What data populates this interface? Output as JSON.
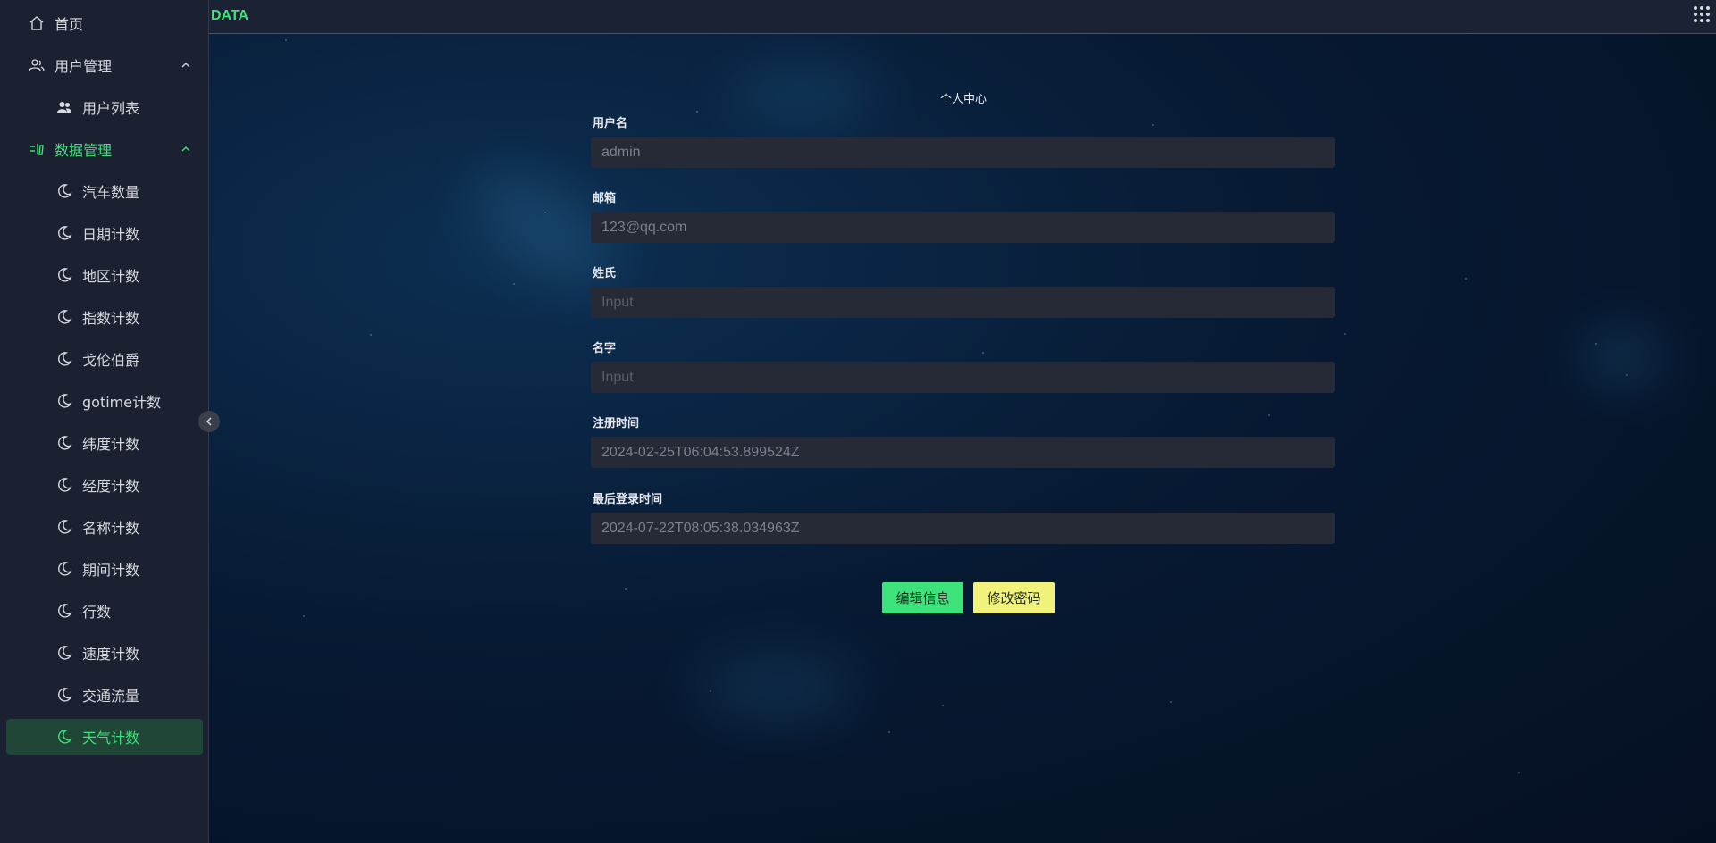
{
  "header": {
    "brand": "DATA"
  },
  "sidebar": {
    "home": "首页",
    "user_group": "用户管理",
    "user_list": "用户列表",
    "data_group": "数据管理",
    "data_items": [
      "汽车数量",
      "日期计数",
      "地区计数",
      "指数计数",
      "戈伦伯爵",
      "gotime计数",
      "纬度计数",
      "经度计数",
      "名称计数",
      "期间计数",
      "行数",
      "速度计数",
      "交通流量",
      "天气计数"
    ],
    "selected": "天气计数"
  },
  "form": {
    "title": "个人中心",
    "fields": [
      {
        "label": "用户名",
        "value": "admin",
        "placeholder": ""
      },
      {
        "label": "邮箱",
        "value": "123@qq.com",
        "placeholder": ""
      },
      {
        "label": "姓氏",
        "value": "",
        "placeholder": "Input"
      },
      {
        "label": "名字",
        "value": "",
        "placeholder": "Input"
      },
      {
        "label": "注册时间",
        "value": "2024-02-25T06:04:53.899524Z",
        "placeholder": ""
      },
      {
        "label": "最后登录时间",
        "value": "2024-07-22T08:05:38.034963Z",
        "placeholder": ""
      }
    ],
    "edit_button": "编辑信息",
    "password_button": "修改密码"
  },
  "colors": {
    "accent": "#3ee27a",
    "secondary_button": "#f0f27c",
    "sidebar_bg": "#1c2131",
    "input_bg": "#262936"
  }
}
